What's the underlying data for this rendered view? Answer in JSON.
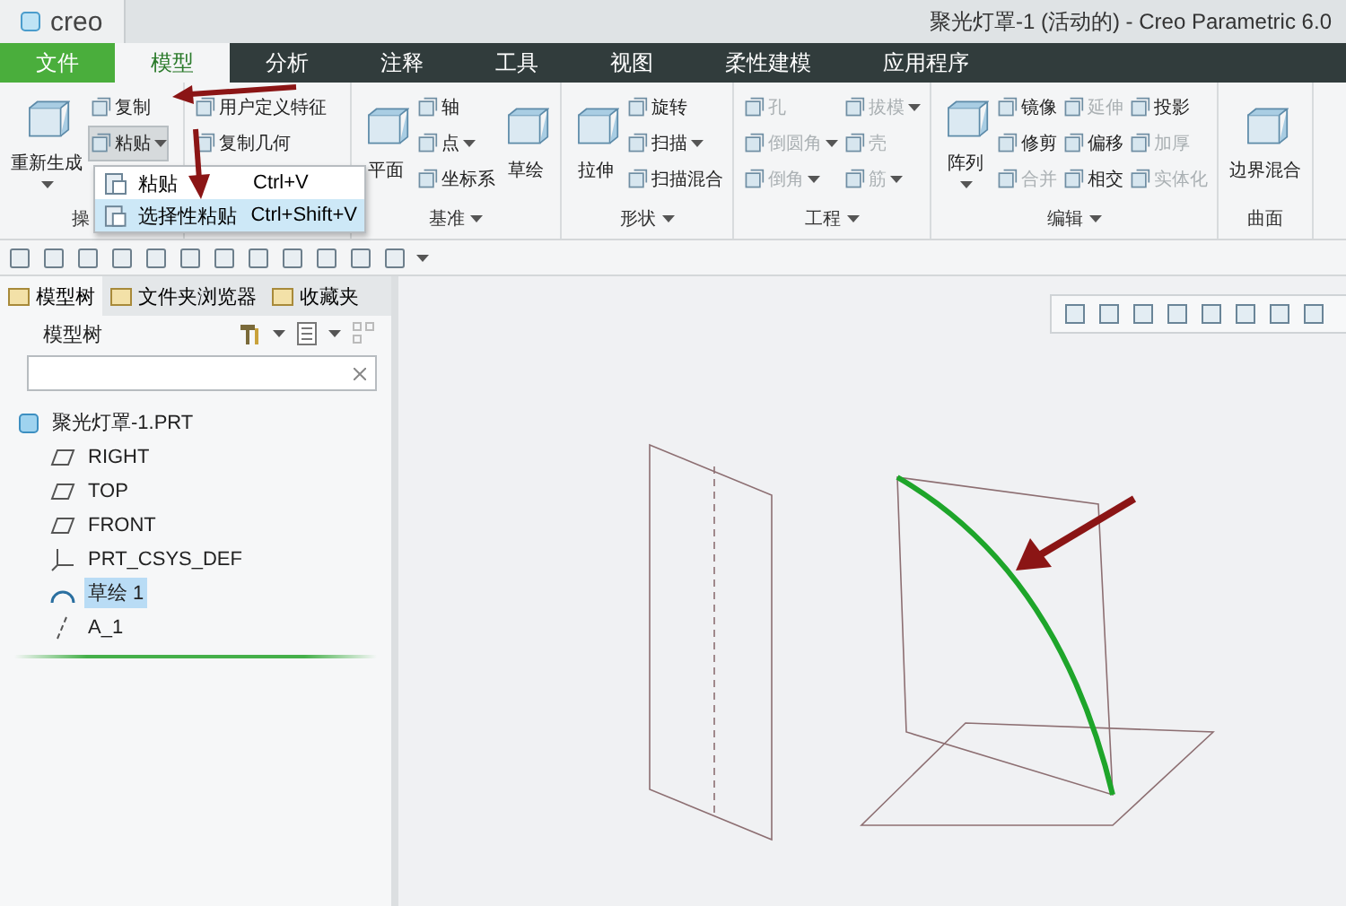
{
  "window": {
    "app_name": "creo",
    "title": "聚光灯罩-1 (活动的) - Creo Parametric 6.0"
  },
  "tabs": [
    {
      "label": "文件",
      "kind": "file",
      "selected": false
    },
    {
      "label": "模型",
      "kind": "normal",
      "selected": true
    },
    {
      "label": "分析",
      "kind": "normal",
      "selected": false
    },
    {
      "label": "注释",
      "kind": "normal",
      "selected": false
    },
    {
      "label": "工具",
      "kind": "normal",
      "selected": false
    },
    {
      "label": "视图",
      "kind": "normal",
      "selected": false
    },
    {
      "label": "柔性建模",
      "kind": "normal",
      "selected": false
    },
    {
      "label": "应用程序",
      "kind": "normal",
      "selected": false
    }
  ],
  "ribbon": {
    "groups": [
      {
        "label": "操",
        "dropdown": false,
        "items": [
          {
            "label": "重新生成",
            "kind": "large",
            "dropdown": true,
            "disabled": false,
            "expanded": false
          },
          {
            "label": "复制",
            "kind": "small",
            "dropdown": false,
            "disabled": false,
            "expanded": false
          },
          {
            "label": "粘贴",
            "kind": "small",
            "dropdown": true,
            "disabled": false,
            "expanded": true
          }
        ]
      },
      {
        "items": [
          {
            "label": "用户定义特征",
            "kind": "small",
            "dropdown": false,
            "disabled": false,
            "expanded": false
          },
          {
            "label": "复制几何",
            "kind": "small",
            "dropdown": false,
            "disabled": false,
            "expanded": false
          }
        ]
      },
      {
        "label": "基准",
        "dropdown": true,
        "items": [
          {
            "label": "平面",
            "kind": "large",
            "dropdown": false,
            "disabled": false,
            "expanded": false
          },
          {
            "label": "轴",
            "kind": "small",
            "dropdown": false,
            "disabled": false,
            "expanded": false
          },
          {
            "label": "点",
            "kind": "small",
            "dropdown": true,
            "disabled": false,
            "expanded": false
          },
          {
            "label": "坐标系",
            "kind": "small",
            "dropdown": false,
            "disabled": false,
            "expanded": false
          },
          {
            "label": "草绘",
            "kind": "large",
            "dropdown": false,
            "disabled": false,
            "expanded": false
          }
        ]
      },
      {
        "label": "形状",
        "dropdown": true,
        "items": [
          {
            "label": "拉伸",
            "kind": "large",
            "dropdown": false,
            "disabled": false,
            "expanded": false
          },
          {
            "label": "旋转",
            "kind": "small",
            "dropdown": false,
            "disabled": false,
            "expanded": false
          },
          {
            "label": "扫描",
            "kind": "small",
            "dropdown": true,
            "disabled": false,
            "expanded": false
          },
          {
            "label": "扫描混合",
            "kind": "small",
            "dropdown": false,
            "disabled": false,
            "expanded": false
          }
        ]
      },
      {
        "label": "工程",
        "dropdown": true,
        "items": [
          {
            "label": "孔",
            "kind": "small",
            "dropdown": false,
            "disabled": true,
            "expanded": false
          },
          {
            "label": "倒圆角",
            "kind": "small",
            "dropdown": true,
            "disabled": true,
            "expanded": false
          },
          {
            "label": "倒角",
            "kind": "small",
            "dropdown": true,
            "disabled": true,
            "expanded": false
          },
          {
            "label": "拔模",
            "kind": "small",
            "dropdown": true,
            "disabled": true,
            "expanded": false
          },
          {
            "label": "壳",
            "kind": "small",
            "dropdown": false,
            "disabled": true,
            "expanded": false
          },
          {
            "label": "筋",
            "kind": "small",
            "dropdown": true,
            "disabled": true,
            "expanded": false
          }
        ]
      },
      {
        "label": "编辑",
        "dropdown": true,
        "items": [
          {
            "label": "阵列",
            "kind": "large",
            "dropdown": true,
            "disabled": false,
            "expanded": false
          },
          {
            "label": "镜像",
            "kind": "small",
            "dropdown": false,
            "disabled": false,
            "expanded": false
          },
          {
            "label": "修剪",
            "kind": "small",
            "dropdown": false,
            "disabled": false,
            "expanded": false
          },
          {
            "label": "合并",
            "kind": "small",
            "dropdown": false,
            "disabled": true,
            "expanded": false
          },
          {
            "label": "延伸",
            "kind": "small",
            "dropdown": false,
            "disabled": true,
            "expanded": false
          },
          {
            "label": "偏移",
            "kind": "small",
            "dropdown": false,
            "disabled": false,
            "expanded": false
          },
          {
            "label": "相交",
            "kind": "small",
            "dropdown": false,
            "disabled": false,
            "expanded": false
          },
          {
            "label": "投影",
            "kind": "small",
            "dropdown": false,
            "disabled": false,
            "expanded": false
          },
          {
            "label": "加厚",
            "kind": "small",
            "dropdown": false,
            "disabled": true,
            "expanded": false
          },
          {
            "label": "实体化",
            "kind": "small",
            "dropdown": false,
            "disabled": true,
            "expanded": false
          }
        ]
      },
      {
        "label": "曲面",
        "dropdown": false,
        "items": [
          {
            "label": "边界混合",
            "kind": "large",
            "dropdown": false,
            "disabled": false,
            "expanded": false
          }
        ]
      }
    ]
  },
  "paste_menu": {
    "items": [
      {
        "label": "粘贴",
        "shortcut": "Ctrl+V",
        "selected": false
      },
      {
        "label": "选择性粘贴",
        "shortcut": "Ctrl+Shift+V",
        "selected": true
      }
    ]
  },
  "panel": {
    "tabs": [
      {
        "label": "模型树",
        "selected": true
      },
      {
        "label": "文件夹浏览器",
        "selected": false
      },
      {
        "label": "收藏夹",
        "selected": false
      }
    ],
    "title": "模型树",
    "tree": {
      "label": "聚光灯罩-1.PRT",
      "children": [
        {
          "label": "RIGHT",
          "kind": "plane",
          "selected": false
        },
        {
          "label": "TOP",
          "kind": "plane",
          "selected": false
        },
        {
          "label": "FRONT",
          "kind": "plane",
          "selected": false
        },
        {
          "label": "PRT_CSYS_DEF",
          "kind": "csys",
          "selected": false
        },
        {
          "label": "草绘 1",
          "kind": "sketch",
          "selected": true
        },
        {
          "label": "A_1",
          "kind": "axis",
          "selected": false
        }
      ]
    }
  }
}
